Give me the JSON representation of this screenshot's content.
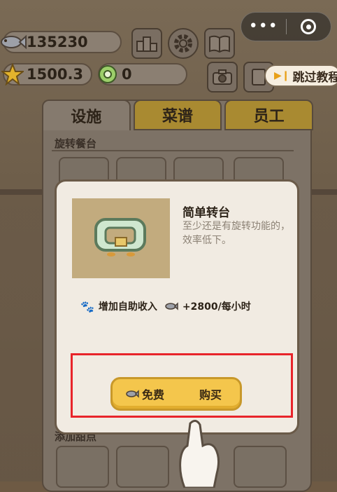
{
  "currency": {
    "fish": "135230",
    "stars": "1500.3",
    "coins": "0"
  },
  "top_icons": [
    "rank-icon",
    "gear-icon",
    "book-icon",
    "camera-icon",
    "photo-icon"
  ],
  "capsule": {
    "more": "•••",
    "close": ""
  },
  "skip_tutorial": "跳过教程",
  "tabs": [
    {
      "label": "设施",
      "active": true
    },
    {
      "label": "菜谱",
      "active": false
    },
    {
      "label": "员工",
      "active": false
    }
  ],
  "section_title": "旋转餐台",
  "section2_title": "添加甜点",
  "modal": {
    "item_name": "简单转台",
    "item_desc": "至少还是有旋转功能的，效率低下。",
    "effect_label": "增加自助收入",
    "effect_value": "+2800/每小时",
    "free_label": "免费",
    "buy_label": "购买"
  },
  "colors": {
    "highlight": "#e8242a",
    "button": "#f4c64c",
    "tab_gold": "#a98a31"
  }
}
